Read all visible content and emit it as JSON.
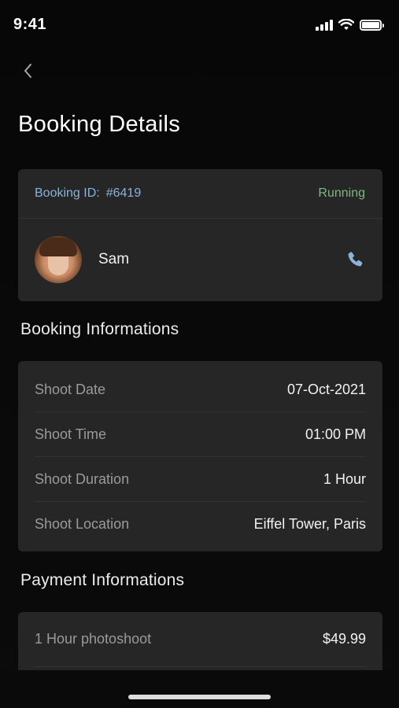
{
  "status_bar": {
    "time": "9:41"
  },
  "header": {
    "title": "Booking Details"
  },
  "booking": {
    "id_label": "Booking ID:",
    "id_value": "#6419",
    "status": "Running",
    "user_name": "Sam"
  },
  "booking_info": {
    "title": "Booking Informations",
    "rows": [
      {
        "label": "Shoot Date",
        "value": "07-Oct-2021"
      },
      {
        "label": "Shoot Time",
        "value": "01:00 PM"
      },
      {
        "label": "Shoot Duration",
        "value": "1 Hour"
      },
      {
        "label": "Shoot Location",
        "value": "Eiffel Tower, Paris"
      }
    ]
  },
  "payment_info": {
    "title": "Payment Informations",
    "rows": [
      {
        "label": "1 Hour photoshoot",
        "value": "$49.99"
      }
    ]
  },
  "colors": {
    "background": "#0a0a0a",
    "card": "#262626",
    "accent_blue": "#8bb2d9",
    "status_green": "#7fb77e"
  },
  "icons": {
    "back": "chevron-left-icon",
    "call": "phone-icon",
    "signal": "cellular-signal-icon",
    "wifi": "wifi-icon",
    "battery": "battery-icon"
  }
}
